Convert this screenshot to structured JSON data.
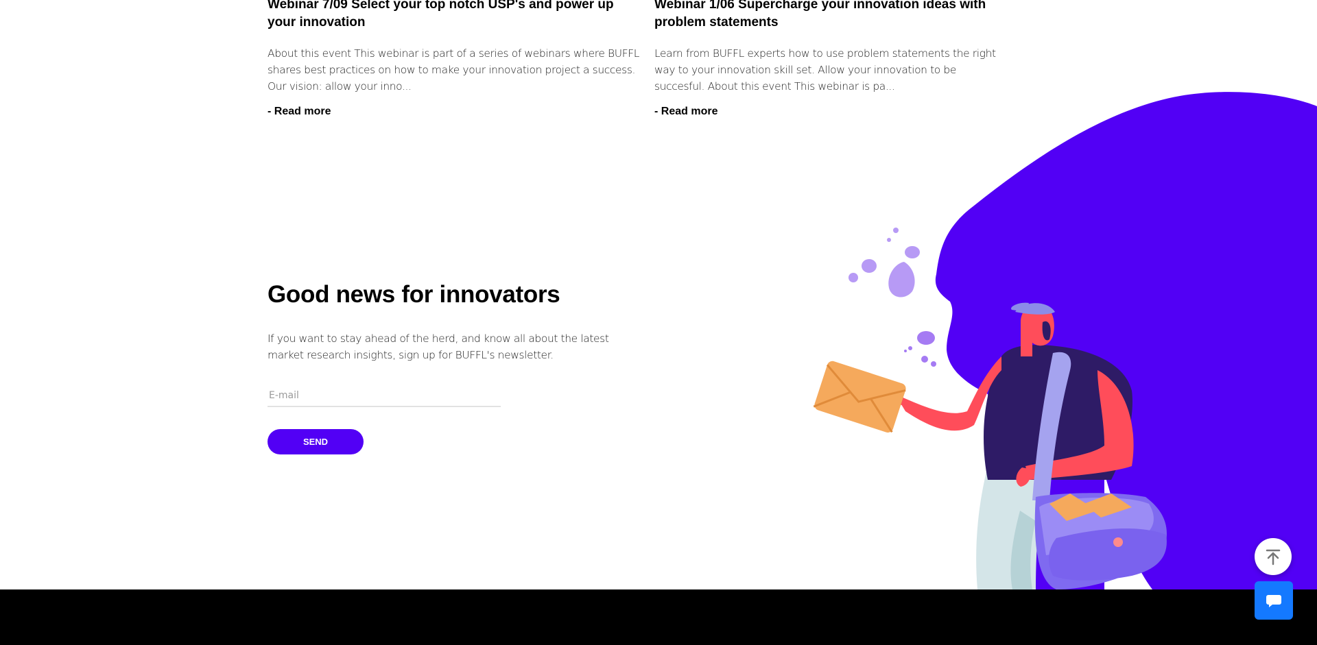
{
  "webinars": [
    {
      "title": "Webinar 7/09 Select your top notch USP's and power up your innovation",
      "excerpt": "About this event This webinar is part of a series of webinars where BUFFL shares best practices on how to make your innovation project a success. Our vision: allow your inno...",
      "read_more": "- Read more"
    },
    {
      "title": "Webinar 1/06 Supercharge your innovation ideas with problem statements",
      "excerpt": "Learn from BUFFL experts how to use problem statements the right way to your innovation skill set. Allow your innovation to be succesful. About this event This webinar is pa...",
      "read_more": "- Read more"
    }
  ],
  "newsletter": {
    "heading": "Good news for innovators",
    "description": "If you want to stay ahead of the herd, and know all about the latest market research insights, sign up for BUFFL's newsletter.",
    "email_placeholder": "E-mail",
    "send_label": "SEND"
  },
  "illustration": {
    "subject": "mail-carrier-illustration"
  },
  "floating": {
    "scroll_top_icon": "arrow-up-to-top-icon",
    "chat_icon": "chat-bubble-icon"
  },
  "colors": {
    "accent": "#5200f5",
    "blob": "#5200f5",
    "chat_button": "#1479ff",
    "footer": "#000000"
  }
}
